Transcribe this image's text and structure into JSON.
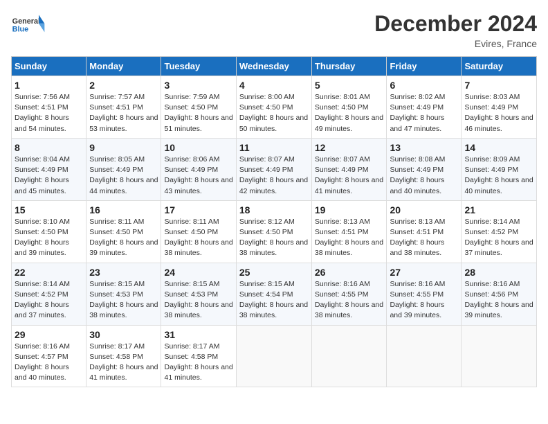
{
  "header": {
    "logo_general": "General",
    "logo_blue": "Blue",
    "month_title": "December 2024",
    "location": "Evires, France"
  },
  "days_of_week": [
    "Sunday",
    "Monday",
    "Tuesday",
    "Wednesday",
    "Thursday",
    "Friday",
    "Saturday"
  ],
  "weeks": [
    [
      {
        "day": "1",
        "sunrise": "7:56 AM",
        "sunset": "4:51 PM",
        "daylight": "8 hours and 54 minutes."
      },
      {
        "day": "2",
        "sunrise": "7:57 AM",
        "sunset": "4:51 PM",
        "daylight": "8 hours and 53 minutes."
      },
      {
        "day": "3",
        "sunrise": "7:59 AM",
        "sunset": "4:50 PM",
        "daylight": "8 hours and 51 minutes."
      },
      {
        "day": "4",
        "sunrise": "8:00 AM",
        "sunset": "4:50 PM",
        "daylight": "8 hours and 50 minutes."
      },
      {
        "day": "5",
        "sunrise": "8:01 AM",
        "sunset": "4:50 PM",
        "daylight": "8 hours and 49 minutes."
      },
      {
        "day": "6",
        "sunrise": "8:02 AM",
        "sunset": "4:49 PM",
        "daylight": "8 hours and 47 minutes."
      },
      {
        "day": "7",
        "sunrise": "8:03 AM",
        "sunset": "4:49 PM",
        "daylight": "8 hours and 46 minutes."
      }
    ],
    [
      {
        "day": "8",
        "sunrise": "8:04 AM",
        "sunset": "4:49 PM",
        "daylight": "8 hours and 45 minutes."
      },
      {
        "day": "9",
        "sunrise": "8:05 AM",
        "sunset": "4:49 PM",
        "daylight": "8 hours and 44 minutes."
      },
      {
        "day": "10",
        "sunrise": "8:06 AM",
        "sunset": "4:49 PM",
        "daylight": "8 hours and 43 minutes."
      },
      {
        "day": "11",
        "sunrise": "8:07 AM",
        "sunset": "4:49 PM",
        "daylight": "8 hours and 42 minutes."
      },
      {
        "day": "12",
        "sunrise": "8:07 AM",
        "sunset": "4:49 PM",
        "daylight": "8 hours and 41 minutes."
      },
      {
        "day": "13",
        "sunrise": "8:08 AM",
        "sunset": "4:49 PM",
        "daylight": "8 hours and 40 minutes."
      },
      {
        "day": "14",
        "sunrise": "8:09 AM",
        "sunset": "4:49 PM",
        "daylight": "8 hours and 40 minutes."
      }
    ],
    [
      {
        "day": "15",
        "sunrise": "8:10 AM",
        "sunset": "4:50 PM",
        "daylight": "8 hours and 39 minutes."
      },
      {
        "day": "16",
        "sunrise": "8:11 AM",
        "sunset": "4:50 PM",
        "daylight": "8 hours and 39 minutes."
      },
      {
        "day": "17",
        "sunrise": "8:11 AM",
        "sunset": "4:50 PM",
        "daylight": "8 hours and 38 minutes."
      },
      {
        "day": "18",
        "sunrise": "8:12 AM",
        "sunset": "4:50 PM",
        "daylight": "8 hours and 38 minutes."
      },
      {
        "day": "19",
        "sunrise": "8:13 AM",
        "sunset": "4:51 PM",
        "daylight": "8 hours and 38 minutes."
      },
      {
        "day": "20",
        "sunrise": "8:13 AM",
        "sunset": "4:51 PM",
        "daylight": "8 hours and 38 minutes."
      },
      {
        "day": "21",
        "sunrise": "8:14 AM",
        "sunset": "4:52 PM",
        "daylight": "8 hours and 37 minutes."
      }
    ],
    [
      {
        "day": "22",
        "sunrise": "8:14 AM",
        "sunset": "4:52 PM",
        "daylight": "8 hours and 37 minutes."
      },
      {
        "day": "23",
        "sunrise": "8:15 AM",
        "sunset": "4:53 PM",
        "daylight": "8 hours and 38 minutes."
      },
      {
        "day": "24",
        "sunrise": "8:15 AM",
        "sunset": "4:53 PM",
        "daylight": "8 hours and 38 minutes."
      },
      {
        "day": "25",
        "sunrise": "8:15 AM",
        "sunset": "4:54 PM",
        "daylight": "8 hours and 38 minutes."
      },
      {
        "day": "26",
        "sunrise": "8:16 AM",
        "sunset": "4:55 PM",
        "daylight": "8 hours and 38 minutes."
      },
      {
        "day": "27",
        "sunrise": "8:16 AM",
        "sunset": "4:55 PM",
        "daylight": "8 hours and 39 minutes."
      },
      {
        "day": "28",
        "sunrise": "8:16 AM",
        "sunset": "4:56 PM",
        "daylight": "8 hours and 39 minutes."
      }
    ],
    [
      {
        "day": "29",
        "sunrise": "8:16 AM",
        "sunset": "4:57 PM",
        "daylight": "8 hours and 40 minutes."
      },
      {
        "day": "30",
        "sunrise": "8:17 AM",
        "sunset": "4:58 PM",
        "daylight": "8 hours and 41 minutes."
      },
      {
        "day": "31",
        "sunrise": "8:17 AM",
        "sunset": "4:58 PM",
        "daylight": "8 hours and 41 minutes."
      },
      null,
      null,
      null,
      null
    ]
  ],
  "labels": {
    "sunrise": "Sunrise:",
    "sunset": "Sunset:",
    "daylight": "Daylight:"
  }
}
